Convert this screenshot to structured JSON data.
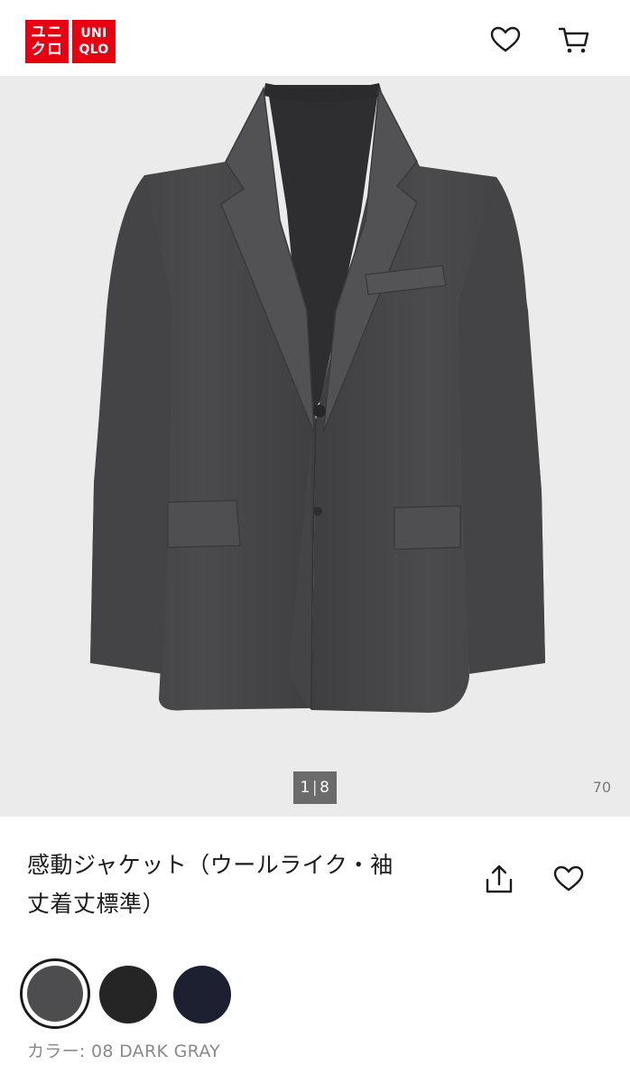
{
  "header": {
    "logo_katakana_row1": "ユニ",
    "logo_katakana_row2": "クロ",
    "logo_latin_row1": "UNI",
    "logo_latin_row2": "QLO",
    "icons": [
      "favorite-heart-icon",
      "cart-icon"
    ]
  },
  "gallery": {
    "pager_current": "1",
    "pager_total": "8",
    "count": "70"
  },
  "product": {
    "title_line1": "感動ジャケット（ウールライク・袖",
    "title_line2": "丈着丈標準）",
    "icons": [
      "share-icon",
      "favorite-heart-icon"
    ]
  },
  "colors": {
    "label_prefix": "カラー: ",
    "selected_label": "08 DARK GRAY",
    "swatches": [
      {
        "code": "08",
        "hex": "#4d4d4f",
        "selected": true
      },
      {
        "code": "09",
        "hex": "#252526",
        "selected": false
      },
      {
        "code": "69",
        "hex": "#1c2030",
        "selected": false
      }
    ]
  },
  "theme": {
    "brand_red": "#e60012",
    "gallery_bg": "#ebebeb",
    "jacket_gray": "#4a4a4c"
  }
}
